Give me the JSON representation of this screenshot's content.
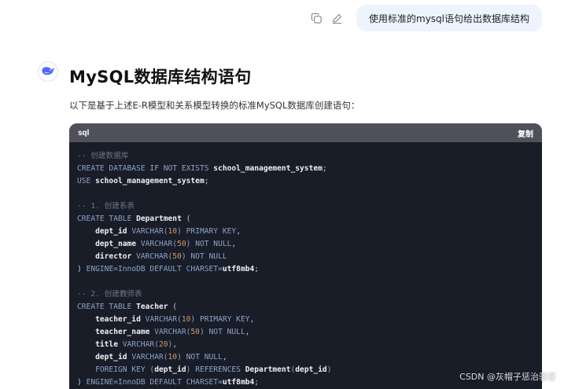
{
  "user_message": {
    "text": "使用标准的mysql语句给出数据库结构",
    "actions": [
      {
        "name": "copy-icon"
      },
      {
        "name": "edit-icon"
      }
    ]
  },
  "assistant": {
    "avatar_icon": "whale-logo-icon",
    "title": "MySQL数据库结构语句",
    "intro": "以下是基于上述E-R模型和关系模型转换的标准MySQL数据库创建语句：",
    "code_block": {
      "language": "sql",
      "copy_label": "复制",
      "lines": [
        [
          {
            "t": "cm",
            "v": "-- 创建数据库"
          }
        ],
        [
          {
            "t": "kw",
            "v": "CREATE DATABASE IF NOT EXISTS "
          },
          {
            "t": "id",
            "v": "school_management_system"
          },
          {
            "t": "punc",
            "v": ";"
          }
        ],
        [
          {
            "t": "kw",
            "v": "USE "
          },
          {
            "t": "id",
            "v": "school_management_system"
          },
          {
            "t": "punc",
            "v": ";"
          }
        ],
        [],
        [
          {
            "t": "cm",
            "v": "-- 1. 创建系表"
          }
        ],
        [
          {
            "t": "kw",
            "v": "CREATE TABLE "
          },
          {
            "t": "id",
            "v": "Department"
          },
          {
            "t": "punc",
            "v": " ("
          }
        ],
        [
          {
            "t": "id",
            "v": "    dept_id"
          },
          {
            "t": "kw",
            "v": " VARCHAR("
          },
          {
            "t": "num",
            "v": "10"
          },
          {
            "t": "kw",
            "v": ") PRIMARY KEY"
          },
          {
            "t": "punc",
            "v": ","
          }
        ],
        [
          {
            "t": "id",
            "v": "    dept_name"
          },
          {
            "t": "kw",
            "v": " VARCHAR("
          },
          {
            "t": "num",
            "v": "50"
          },
          {
            "t": "kw",
            "v": ") NOT NULL"
          },
          {
            "t": "punc",
            "v": ","
          }
        ],
        [
          {
            "t": "id",
            "v": "    director"
          },
          {
            "t": "kw",
            "v": " VARCHAR("
          },
          {
            "t": "num",
            "v": "50"
          },
          {
            "t": "kw",
            "v": ") NOT NULL"
          }
        ],
        [
          {
            "t": "punc",
            "v": ") "
          },
          {
            "t": "kw",
            "v": "ENGINE=InnoDB DEFAULT CHARSET="
          },
          {
            "t": "id",
            "v": "utf8mb4"
          },
          {
            "t": "punc",
            "v": ";"
          }
        ],
        [],
        [
          {
            "t": "cm",
            "v": "-- 2. 创建教师表"
          }
        ],
        [
          {
            "t": "kw",
            "v": "CREATE TABLE "
          },
          {
            "t": "id",
            "v": "Teacher"
          },
          {
            "t": "punc",
            "v": " ("
          }
        ],
        [
          {
            "t": "id",
            "v": "    teacher_id"
          },
          {
            "t": "kw",
            "v": " VARCHAR("
          },
          {
            "t": "num",
            "v": "10"
          },
          {
            "t": "kw",
            "v": ") PRIMARY KEY"
          },
          {
            "t": "punc",
            "v": ","
          }
        ],
        [
          {
            "t": "id",
            "v": "    teacher_name"
          },
          {
            "t": "kw",
            "v": " VARCHAR("
          },
          {
            "t": "num",
            "v": "50"
          },
          {
            "t": "kw",
            "v": ") NOT NULL"
          },
          {
            "t": "punc",
            "v": ","
          }
        ],
        [
          {
            "t": "id",
            "v": "    title"
          },
          {
            "t": "kw",
            "v": " VARCHAR("
          },
          {
            "t": "num",
            "v": "20"
          },
          {
            "t": "kw",
            "v": ")"
          },
          {
            "t": "punc",
            "v": ","
          }
        ],
        [
          {
            "t": "id",
            "v": "    dept_id"
          },
          {
            "t": "kw",
            "v": " VARCHAR("
          },
          {
            "t": "num",
            "v": "10"
          },
          {
            "t": "kw",
            "v": ") NOT NULL"
          },
          {
            "t": "punc",
            "v": ","
          }
        ],
        [
          {
            "t": "kw",
            "v": "    FOREIGN KEY ("
          },
          {
            "t": "id",
            "v": "dept_id"
          },
          {
            "t": "kw",
            "v": ") REFERENCES "
          },
          {
            "t": "id",
            "v": "Department"
          },
          {
            "t": "kw",
            "v": "("
          },
          {
            "t": "id",
            "v": "dept_id"
          },
          {
            "t": "kw",
            "v": ")"
          }
        ],
        [
          {
            "t": "punc",
            "v": ") "
          },
          {
            "t": "kw",
            "v": "ENGINE=InnoDB DEFAULT CHARSET="
          },
          {
            "t": "id",
            "v": "utf8mb4"
          },
          {
            "t": "punc",
            "v": ";"
          }
        ]
      ]
    }
  },
  "watermark": "CSDN @灰帽子惩治骇客",
  "colors": {
    "user_bubble": "#eef4fd",
    "code_bg": "#181d28",
    "code_header": "#50505a",
    "accent": "#4d6bfe"
  }
}
